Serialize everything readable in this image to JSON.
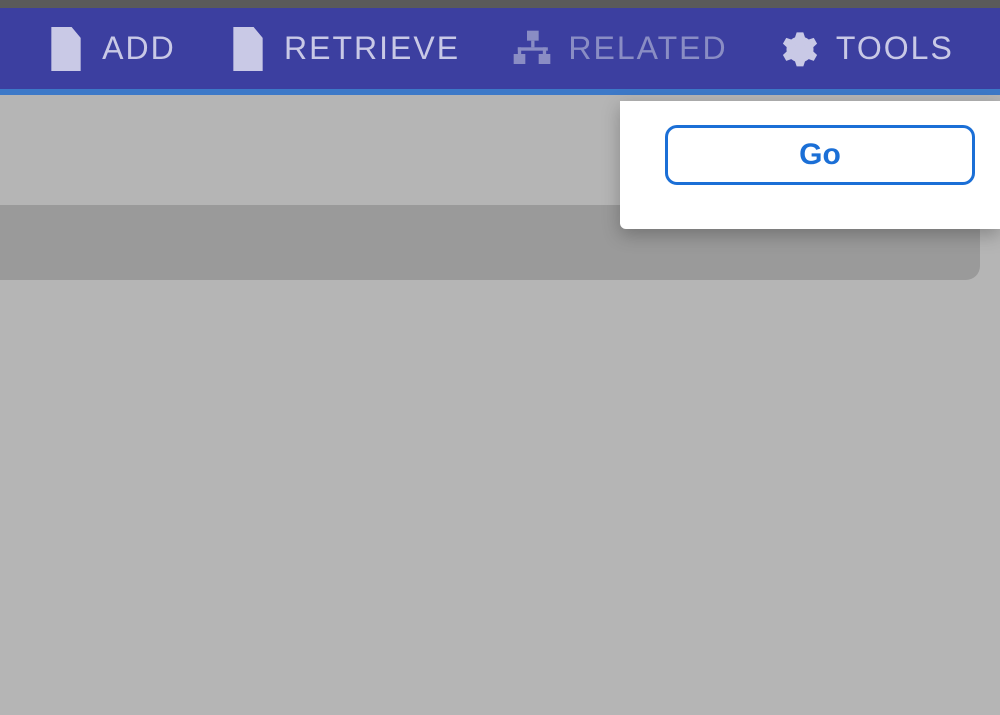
{
  "toolbar": {
    "add_label": "ADD",
    "retrieve_label": "RETRIEVE",
    "related_label": "RELATED",
    "tools_label": "TOOLS"
  },
  "panel": {
    "go_label": "Go"
  }
}
